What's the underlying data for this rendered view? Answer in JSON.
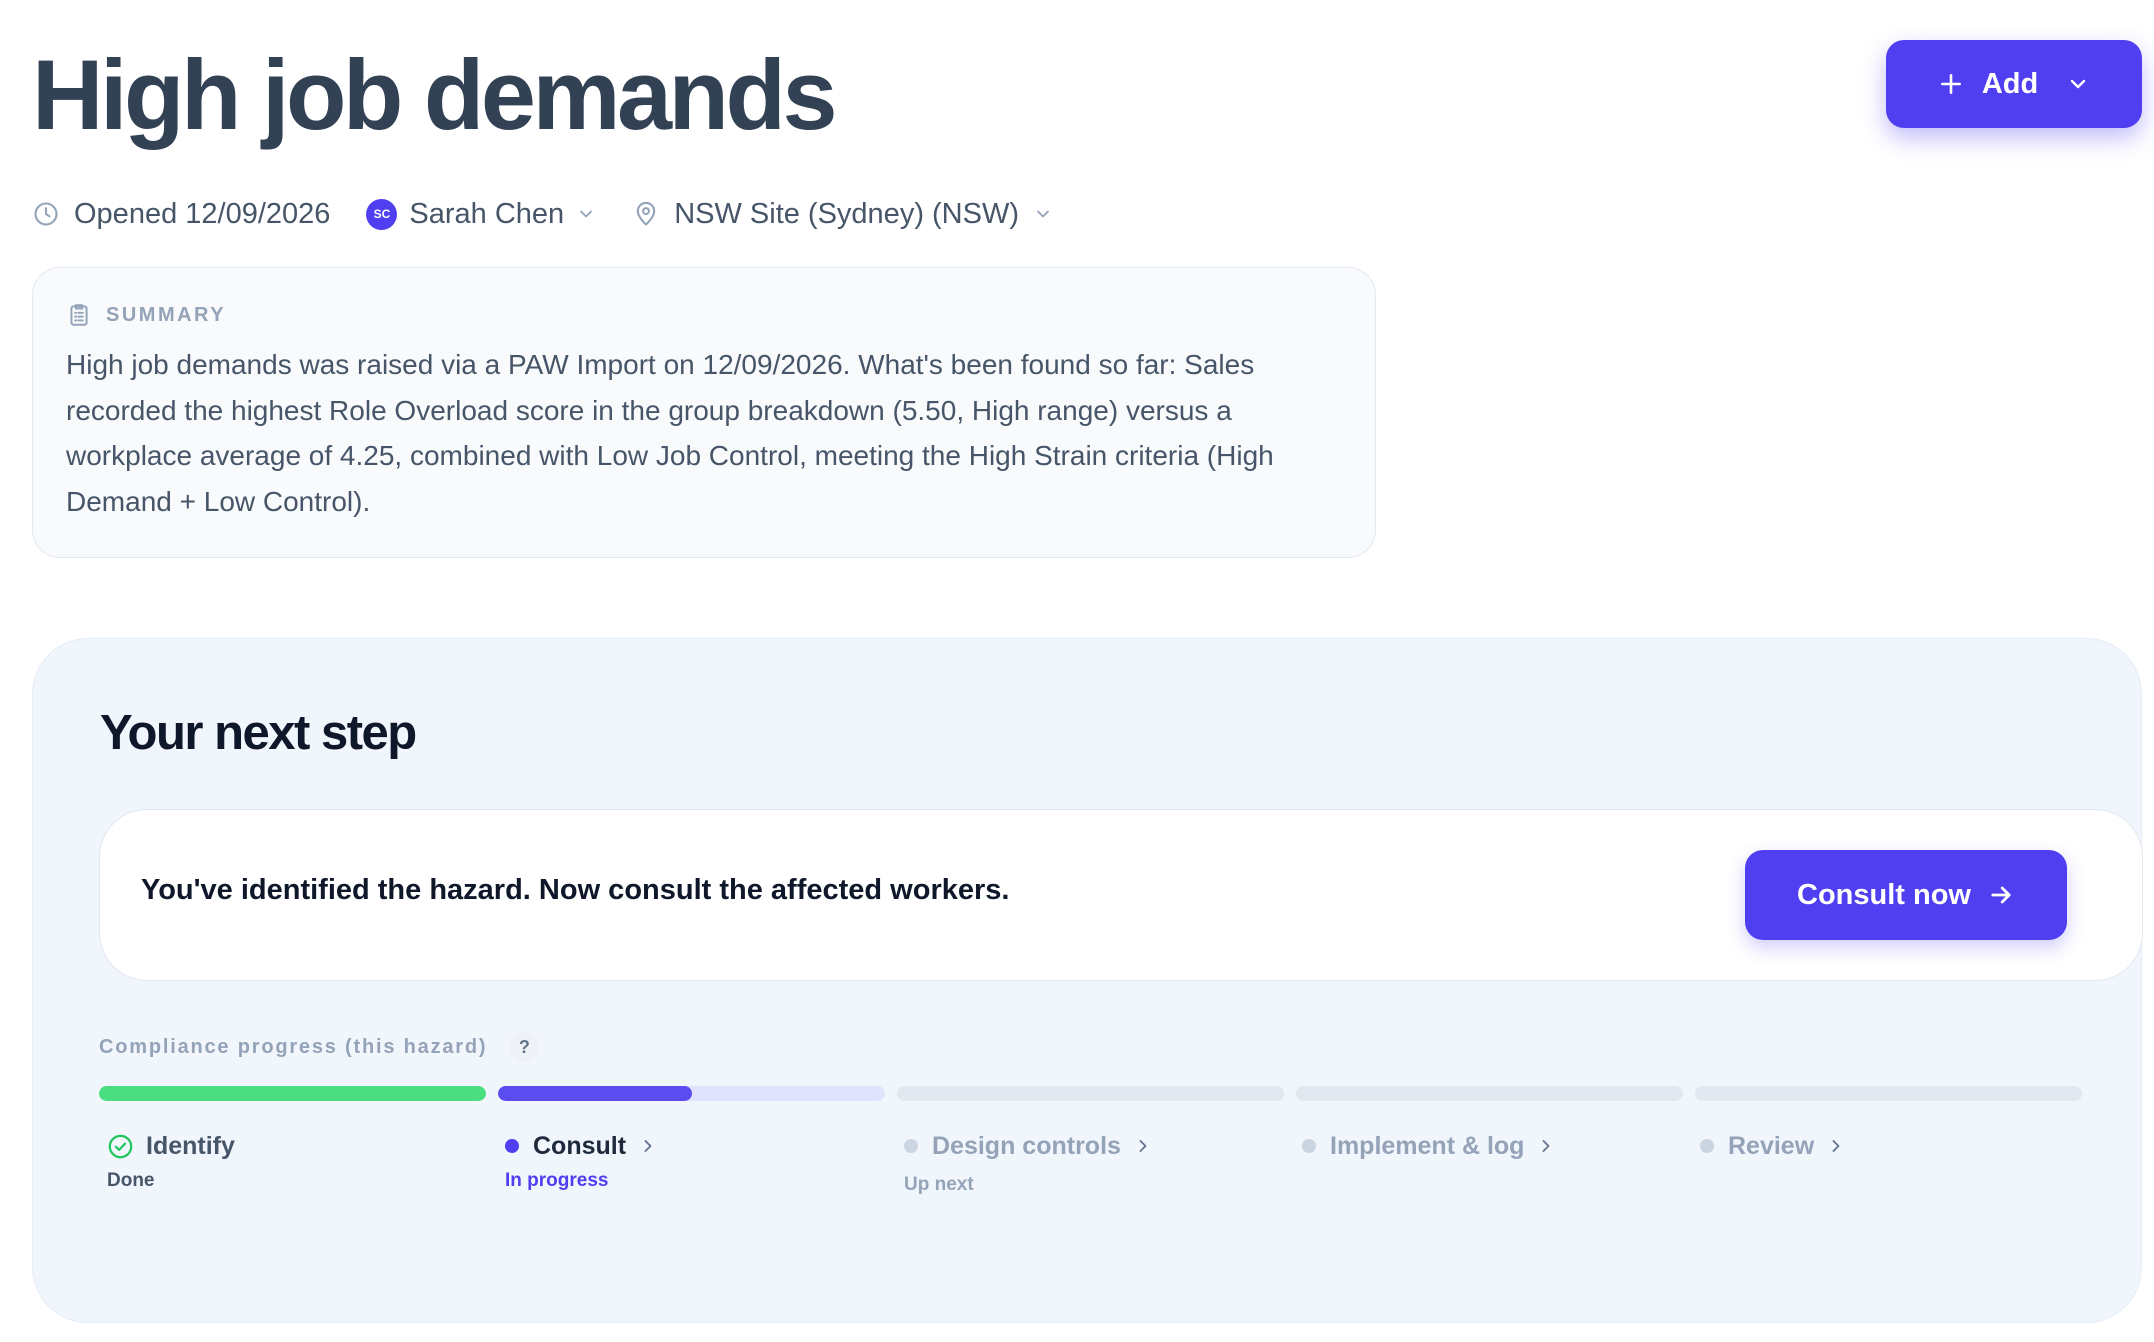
{
  "header": {
    "title": "High job demands",
    "add_label": "Add"
  },
  "meta": {
    "opened": "Opened 12/09/2026",
    "owner_initials": "SC",
    "owner_name": "Sarah Chen",
    "site": "NSW Site (Sydney) (NSW)"
  },
  "summary": {
    "heading": "SUMMARY",
    "text": "High job demands was raised via a PAW Import on 12/09/2026. What's been found so far: Sales recorded the highest Role Overload score in the group breakdown (5.50, High range) versus a workplace average of 4.25, combined with Low Job Control, meeting the High Strain criteria (High Demand + Low Control)."
  },
  "next_step": {
    "title": "Your next step",
    "message": "You've identified the hazard. Now consult the affected workers.",
    "cta_label": "Consult now"
  },
  "progress": {
    "label": "Compliance progress (this hazard)",
    "help": "?",
    "steps": [
      {
        "name": "Identify",
        "status": "Done",
        "state": "done",
        "fill": 1.0
      },
      {
        "name": "Consult",
        "status": "In progress",
        "state": "active",
        "fill": 0.5
      },
      {
        "name": "Design controls",
        "status": "Up next",
        "state": "upcoming",
        "fill": 0
      },
      {
        "name": "Implement & log",
        "status": "",
        "state": "upcoming",
        "fill": 0
      },
      {
        "name": "Review",
        "status": "",
        "state": "upcoming",
        "fill": 0
      }
    ]
  },
  "colors": {
    "accent": "#4f3ff0",
    "done": "#4ade80",
    "title": "#334155",
    "muted": "#94a3b8"
  },
  "icons": [
    "plus-icon",
    "chevron-down-icon",
    "clock-icon",
    "map-pin-icon",
    "clipboard-icon",
    "arrow-right-icon",
    "check-circle-icon",
    "chevron-right-icon"
  ]
}
